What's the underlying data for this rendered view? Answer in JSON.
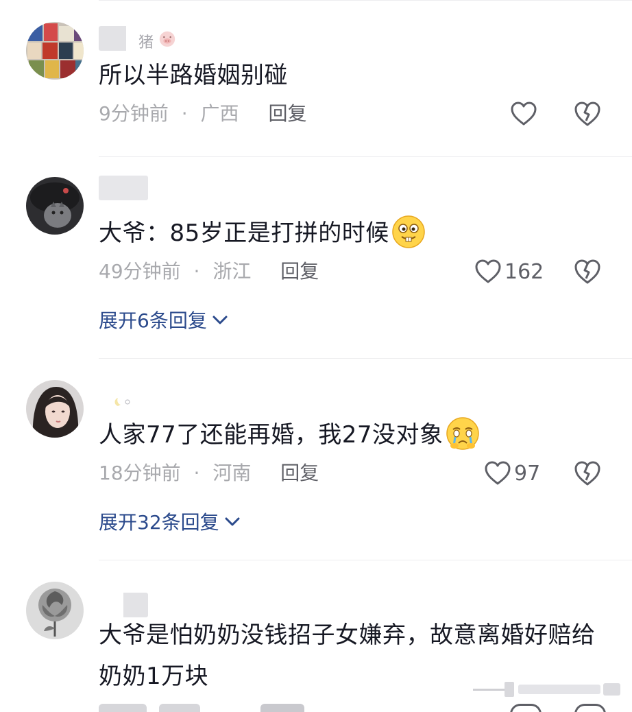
{
  "comments": [
    {
      "username_partial": "猪",
      "text": "所以半路婚姻别碰",
      "time": "9分钟前",
      "location": "广西",
      "reply_label": "回复",
      "likes": ""
    },
    {
      "username_partial": "",
      "text": "大爷：85岁正是打拼的时候",
      "emoji": "smirk-face-emoji",
      "time": "49分钟前",
      "location": "浙江",
      "reply_label": "回复",
      "likes": "162",
      "expand": "展开6条回复"
    },
    {
      "username_partial": "",
      "text": "人家77了还能再婚，我27没对象",
      "emoji": "crying-face-emoji",
      "time": "18分钟前",
      "location": "河南",
      "reply_label": "回复",
      "likes": "97",
      "expand": "展开32条回复"
    },
    {
      "username_partial": "",
      "text_line1": "大爷是怕奶奶没钱招子女嫌弃，故意离婚好赔给",
      "text_line2": "奶奶1万块"
    }
  ],
  "separator": "·",
  "icons": {
    "like": "heart-outline-icon",
    "dislike": "broken-heart-icon",
    "expand": "chevron-down-icon"
  },
  "colors": {
    "text": "#161823",
    "meta": "#a8a9ad",
    "reply": "#5e5f66",
    "expand_link": "#2b4a8c",
    "divider": "#ededef"
  }
}
